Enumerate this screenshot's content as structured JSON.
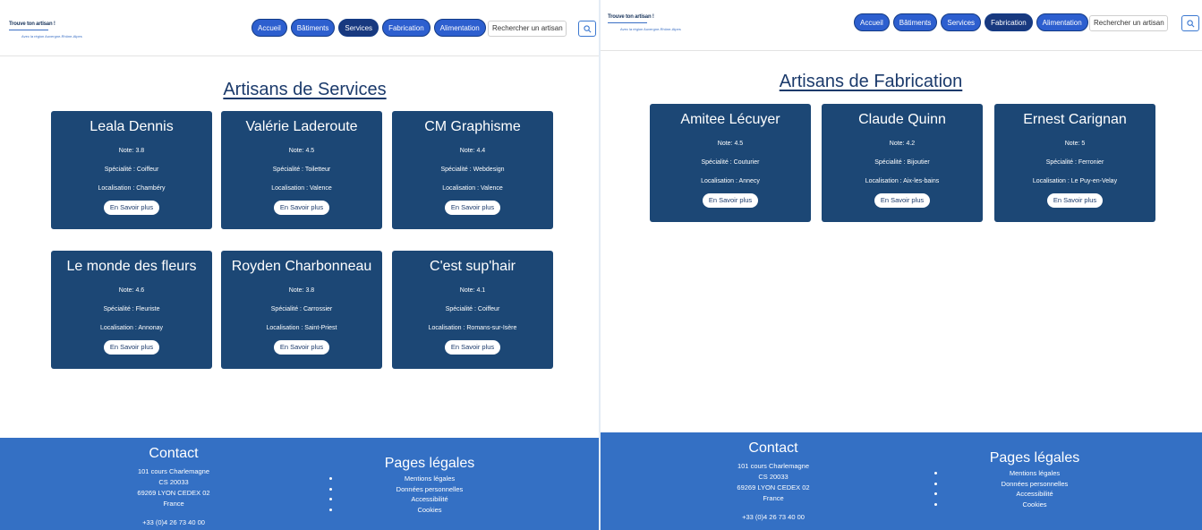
{
  "left": {
    "logo": {
      "title": "Trouve ton artisan !",
      "tagline": "Avec la région Auvergne-Rhône-Alpes"
    },
    "nav": [
      {
        "label": "Accueil",
        "style": "light"
      },
      {
        "label": "Bâtiments",
        "style": "light"
      },
      {
        "label": "Services",
        "style": "dark"
      },
      {
        "label": "Fabrication",
        "style": "light"
      },
      {
        "label": "Alimentation",
        "style": "light"
      }
    ],
    "search": {
      "placeholder": "Rechercher un artisan"
    },
    "page_title": "Artisans de Services",
    "cards": [
      {
        "name": "Leala Dennis",
        "note": "Note: 3.8",
        "specialite": "Spécialité : Coiffeur",
        "localisation": "Localisation : Chambéry",
        "button": "En Savoir plus"
      },
      {
        "name": "Valérie Laderoute",
        "note": "Note: 4.5",
        "specialite": "Spécialité : Toiletteur",
        "localisation": "Localisation : Valence",
        "button": "En Savoir plus"
      },
      {
        "name": "CM Graphisme",
        "note": "Note: 4.4",
        "specialite": "Spécialité : Webdesign",
        "localisation": "Localisation : Valence",
        "button": "En Savoir plus"
      },
      {
        "name": "Le monde des fleurs",
        "note": "Note: 4.6",
        "specialite": "Spécialité : Fleuriste",
        "localisation": "Localisation : Annonay",
        "button": "En Savoir plus"
      },
      {
        "name": "Royden Charbonneau",
        "note": "Note: 3.8",
        "specialite": "Spécialité : Carrossier",
        "localisation": "Localisation : Saint-Priest",
        "button": "En Savoir plus"
      },
      {
        "name": "C'est sup'hair",
        "note": "Note: 4.1",
        "specialite": "Spécialité : Coiffeur",
        "localisation": "Localisation : Romans-sur-Isère",
        "button": "En Savoir plus"
      }
    ],
    "footer": {
      "contact_title": "Contact",
      "address": [
        "101 cours Charlemagne",
        "CS 20033",
        "69269 LYON CEDEX 02",
        "France"
      ],
      "phone": "+33 (0)4 26 73 40 00",
      "legal_title": "Pages légales",
      "legal_links": [
        "Mentions légales",
        "Données personnelles",
        "Accessibilité",
        "Cookies"
      ]
    }
  },
  "right": {
    "logo": {
      "title": "Trouve ton artisan !",
      "tagline": "Avec la région Auvergne-Rhône-Alpes"
    },
    "nav": [
      {
        "label": "Accueil",
        "style": "light"
      },
      {
        "label": "Bâtiments",
        "style": "light"
      },
      {
        "label": "Services",
        "style": "light"
      },
      {
        "label": "Fabrication",
        "style": "dark"
      },
      {
        "label": "Alimentation",
        "style": "light"
      }
    ],
    "search": {
      "placeholder": "Rechercher un artisan"
    },
    "page_title": "Artisans de Fabrication",
    "cards": [
      {
        "name": "Amitee Lécuyer",
        "note": "Note: 4.5",
        "specialite": "Spécialité : Couturier",
        "localisation": "Localisation : Annecy",
        "button": "En Savoir plus"
      },
      {
        "name": "Claude Quinn",
        "note": "Note: 4.2",
        "specialite": "Spécialité : Bijoutier",
        "localisation": "Localisation : Aix-les-bains",
        "button": "En Savoir plus"
      },
      {
        "name": "Ernest Carignan",
        "note": "Note: 5",
        "specialite": "Spécialité : Ferronier",
        "localisation": "Localisation : Le Puy-en-Velay",
        "button": "En Savoir plus"
      }
    ],
    "footer": {
      "contact_title": "Contact",
      "address": [
        "101 cours Charlemagne",
        "CS 20033",
        "69269 LYON CEDEX 02",
        "France"
      ],
      "phone": "+33 (0)4 26 73 40 00",
      "legal_title": "Pages légales",
      "legal_links": [
        "Mentions légales",
        "Données personnelles",
        "Accessibilité",
        "Cookies"
      ]
    }
  }
}
